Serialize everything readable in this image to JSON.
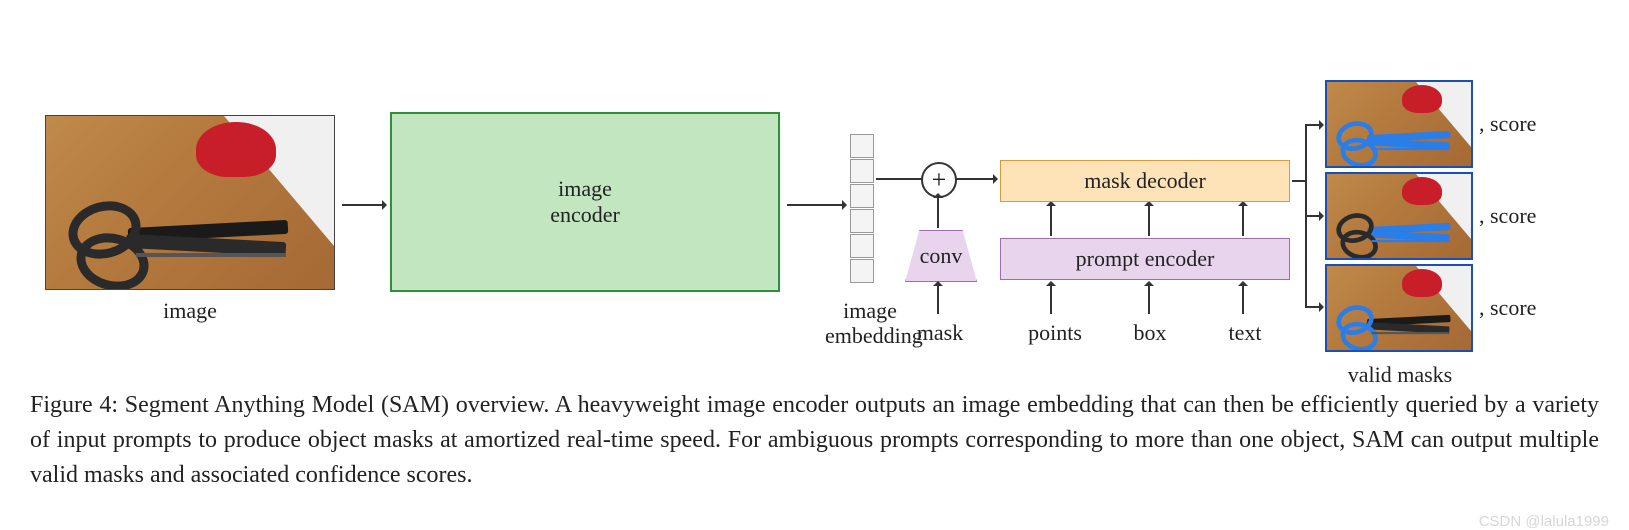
{
  "diagram": {
    "input_label": "image",
    "encoder_label": "image\nencoder",
    "embedding_label": "image\nembedding",
    "conv_label": "conv",
    "conv_input_label": "mask",
    "prompt_encoder_label": "prompt encoder",
    "prompt_inputs": {
      "points": "points",
      "box": "box",
      "text": "text"
    },
    "mask_decoder_label": "mask decoder",
    "output_score_label": ", score",
    "output_label": "valid masks"
  },
  "caption": "Figure 4: Segment Anything Model (SAM) overview. A heavyweight image encoder outputs an image embedding that can then be efficiently queried by a variety of input prompts to produce object masks at amortized real-time speed. For ambiguous prompts corresponding to more than one object, SAM can output multiple valid masks and associated confidence scores.",
  "watermark": "CSDN @lalula1999"
}
